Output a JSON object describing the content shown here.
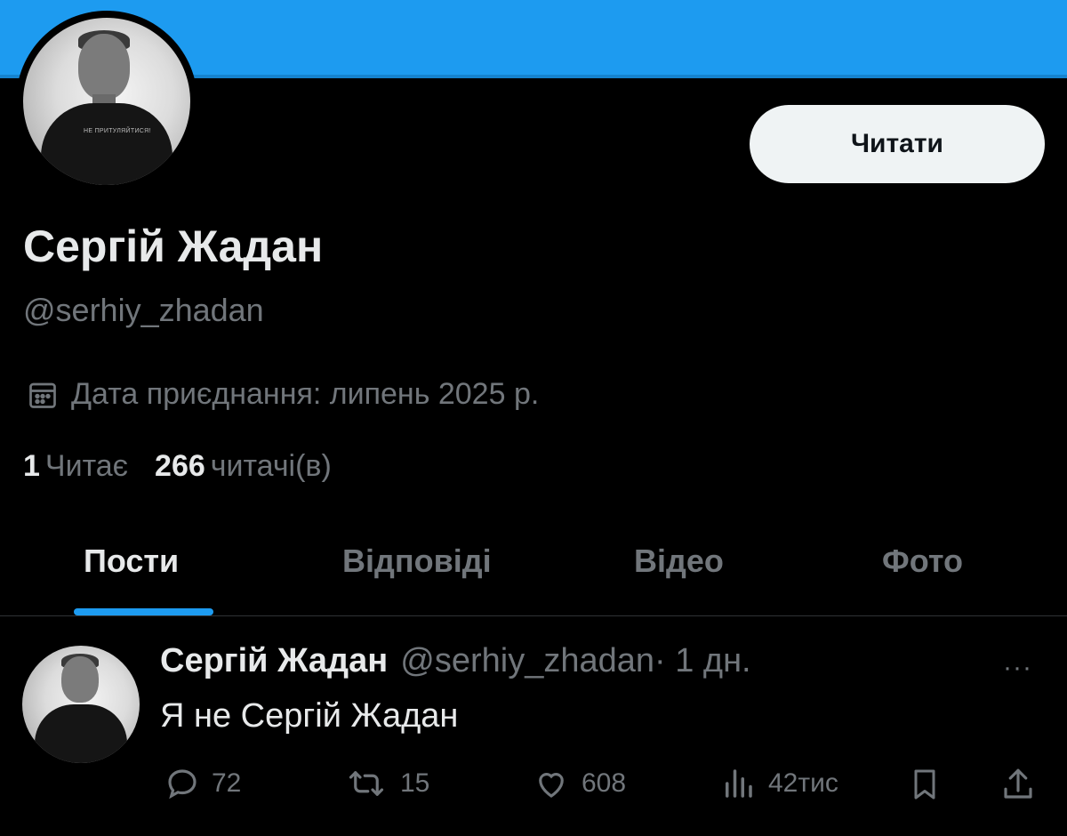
{
  "profile": {
    "follow_button": "Читати",
    "name": "Сергій Жадан",
    "handle": "@serhiy_zhadan",
    "joined": "Дата приєднання: липень 2025 р.",
    "shirt_text": "НЕ ПРИТУЛЯЙТИСЯ!",
    "following_count": "1",
    "following_label": "Читає",
    "followers_count": "266",
    "followers_label": "читачі(в)"
  },
  "tabs": [
    {
      "label": "Пости",
      "active": true
    },
    {
      "label": "Відповіді",
      "active": false
    },
    {
      "label": "Відео",
      "active": false
    },
    {
      "label": "Фото",
      "active": false
    }
  ],
  "post": {
    "author": "Сергій Жадан",
    "handle": "@serhiy_zhadan",
    "time": "· 1 дн.",
    "more": "···",
    "text": "Я не Сергій Жадан",
    "replies": "72",
    "reposts": "15",
    "likes": "608",
    "views": "42тис"
  },
  "colors": {
    "accent": "#1d9bf0",
    "background": "#000000",
    "muted": "#71767b",
    "text": "#e7e9ea"
  }
}
